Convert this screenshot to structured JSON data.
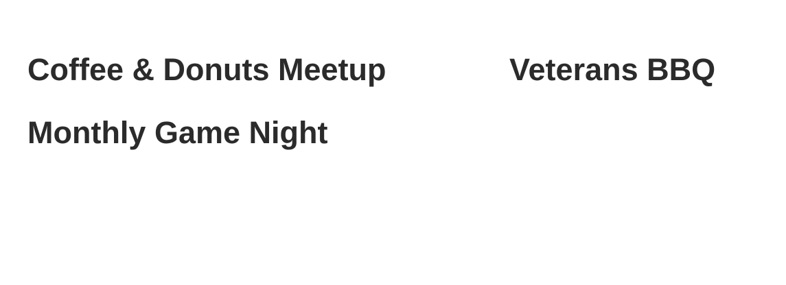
{
  "events": [
    {
      "title": "Coffee & Donuts Meetup"
    },
    {
      "title": "Veterans BBQ"
    },
    {
      "title": "Monthly Game Night"
    }
  ],
  "colors": {
    "background": "#ffffff",
    "text": "#2b2b2b"
  }
}
